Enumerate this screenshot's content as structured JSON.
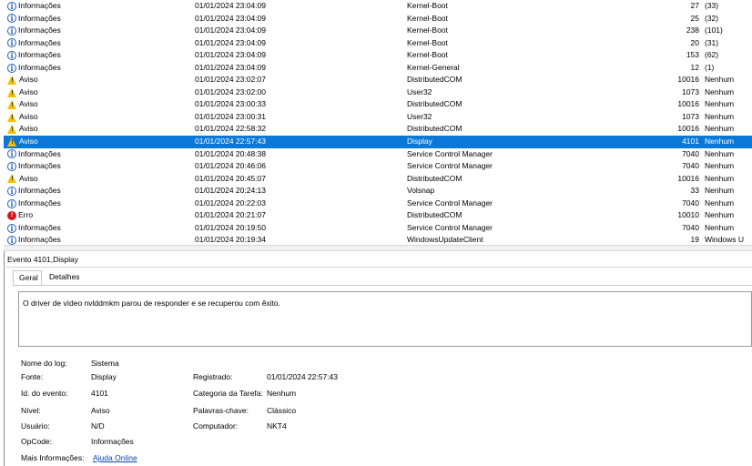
{
  "events": [
    {
      "level": "Informações",
      "icon": "info-icon",
      "datetime": "01/01/2024 23:04:09",
      "source": "Kernel-Boot",
      "event_id": "27",
      "category": "(33)"
    },
    {
      "level": "Informações",
      "icon": "info-icon",
      "datetime": "01/01/2024 23:04:09",
      "source": "Kernel-Boot",
      "event_id": "25",
      "category": "(32)"
    },
    {
      "level": "Informações",
      "icon": "info-icon",
      "datetime": "01/01/2024 23:04:09",
      "source": "Kernel-Boot",
      "event_id": "238",
      "category": "(101)"
    },
    {
      "level": "Informações",
      "icon": "info-icon",
      "datetime": "01/01/2024 23:04:09",
      "source": "Kernel-Boot",
      "event_id": "20",
      "category": "(31)"
    },
    {
      "level": "Informações",
      "icon": "info-icon",
      "datetime": "01/01/2024 23:04:09",
      "source": "Kernel-Boot",
      "event_id": "153",
      "category": "(62)"
    },
    {
      "level": "Informações",
      "icon": "info-icon",
      "datetime": "01/01/2024 23:04:09",
      "source": "Kernel-General",
      "event_id": "12",
      "category": "(1)"
    },
    {
      "level": "Aviso",
      "icon": "warning-icon",
      "datetime": "01/01/2024 23:02:07",
      "source": "DistributedCOM",
      "event_id": "10016",
      "category": "Nenhum"
    },
    {
      "level": "Aviso",
      "icon": "warning-icon",
      "datetime": "01/01/2024 23:02:00",
      "source": "User32",
      "event_id": "1073",
      "category": "Nenhum"
    },
    {
      "level": "Aviso",
      "icon": "warning-icon",
      "datetime": "01/01/2024 23:00:33",
      "source": "DistributedCOM",
      "event_id": "10016",
      "category": "Nenhum"
    },
    {
      "level": "Aviso",
      "icon": "warning-icon",
      "datetime": "01/01/2024 23:00:31",
      "source": "User32",
      "event_id": "1073",
      "category": "Nenhum"
    },
    {
      "level": "Aviso",
      "icon": "warning-icon",
      "datetime": "01/01/2024 22:58:32",
      "source": "DistributedCOM",
      "event_id": "10016",
      "category": "Nenhum"
    },
    {
      "level": "Aviso",
      "icon": "warning-icon",
      "datetime": "01/01/2024 22:57:43",
      "source": "Display",
      "event_id": "4101",
      "category": "Nenhum",
      "selected": true
    },
    {
      "level": "Informações",
      "icon": "info-icon",
      "datetime": "01/01/2024 20:48:38",
      "source": "Service Control Manager",
      "event_id": "7040",
      "category": "Nenhum"
    },
    {
      "level": "Informações",
      "icon": "info-icon",
      "datetime": "01/01/2024 20:46:06",
      "source": "Service Control Manager",
      "event_id": "7040",
      "category": "Nenhum"
    },
    {
      "level": "Aviso",
      "icon": "warning-icon",
      "datetime": "01/01/2024 20:45:07",
      "source": "DistributedCOM",
      "event_id": "10016",
      "category": "Nenhum"
    },
    {
      "level": "Informações",
      "icon": "info-icon",
      "datetime": "01/01/2024 20:24:13",
      "source": "Volsnap",
      "event_id": "33",
      "category": "Nenhum"
    },
    {
      "level": "Informações",
      "icon": "info-icon",
      "datetime": "01/01/2024 20:22:03",
      "source": "Service Control Manager",
      "event_id": "7040",
      "category": "Nenhum"
    },
    {
      "level": "Erro",
      "icon": "error-icon",
      "datetime": "01/01/2024 20:21:07",
      "source": "DistributedCOM",
      "event_id": "10010",
      "category": "Nenhum"
    },
    {
      "level": "Informações",
      "icon": "info-icon",
      "datetime": "01/01/2024 20:19:50",
      "source": "Service Control Manager",
      "event_id": "7040",
      "category": "Nenhum"
    },
    {
      "level": "Informações",
      "icon": "info-icon",
      "datetime": "01/01/2024 20:19:34",
      "source": "WindowsUpdateClient",
      "event_id": "19",
      "category": "Windows U"
    }
  ],
  "detail": {
    "title": "Evento 4101,Display",
    "tabs": [
      "Geral",
      "Detalhes"
    ],
    "description": "O driver de vídeo nvlddmkm parou de responder e se recuperou com êxito.",
    "labels": {
      "log_name": "Nome do log:",
      "source": "Fonte:",
      "event_id": "Id. do evento:",
      "level": "Nível:",
      "user": "Usuário:",
      "opcode": "OpCode:",
      "more_info": "Mais Informações:",
      "logged": "Registrado:",
      "task_category": "Categoria da Tarefa:",
      "keywords": "Palavras-chave:",
      "computer": "Computador:"
    },
    "values": {
      "log_name": "Sistema",
      "source": "Display",
      "event_id": "4101",
      "level": "Aviso",
      "user": "N/D",
      "opcode": "Informações",
      "more_info_link": "Ajuda Online",
      "logged": "01/01/2024 22:57:43",
      "task_category": "Nenhum",
      "keywords": "Clássico",
      "computer": "NKT4"
    }
  },
  "colors": {
    "selection": "#0a78d7",
    "link": "#0645ad",
    "warning": "#f2c200",
    "error": "#d3171a",
    "info": "#1f5fb2"
  }
}
